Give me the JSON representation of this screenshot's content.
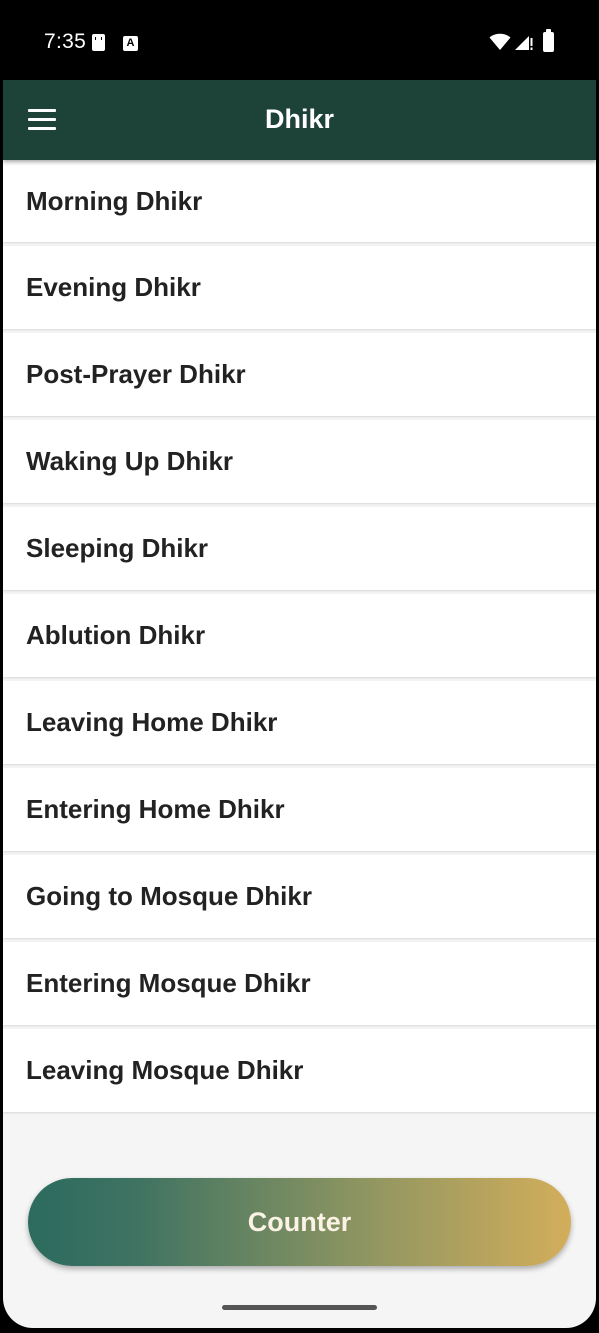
{
  "status_bar": {
    "time": "7:35",
    "notification_letter": "A"
  },
  "app_bar": {
    "title": "Dhikr"
  },
  "dhikr_list": [
    {
      "label": "Morning Dhikr"
    },
    {
      "label": "Evening Dhikr"
    },
    {
      "label": "Post-Prayer Dhikr"
    },
    {
      "label": "Waking Up Dhikr"
    },
    {
      "label": "Sleeping Dhikr"
    },
    {
      "label": "Ablution Dhikr"
    },
    {
      "label": "Leaving Home Dhikr"
    },
    {
      "label": "Entering Home Dhikr"
    },
    {
      "label": "Going to Mosque Dhikr"
    },
    {
      "label": "Entering Mosque Dhikr"
    },
    {
      "label": "Leaving Mosque Dhikr"
    }
  ],
  "counter_button": {
    "label": "Counter"
  },
  "colors": {
    "app_bar": "#1d4339",
    "gradient_start": "#2c6b5e",
    "gradient_end": "#d3ae5b",
    "item_text": "#222222"
  }
}
